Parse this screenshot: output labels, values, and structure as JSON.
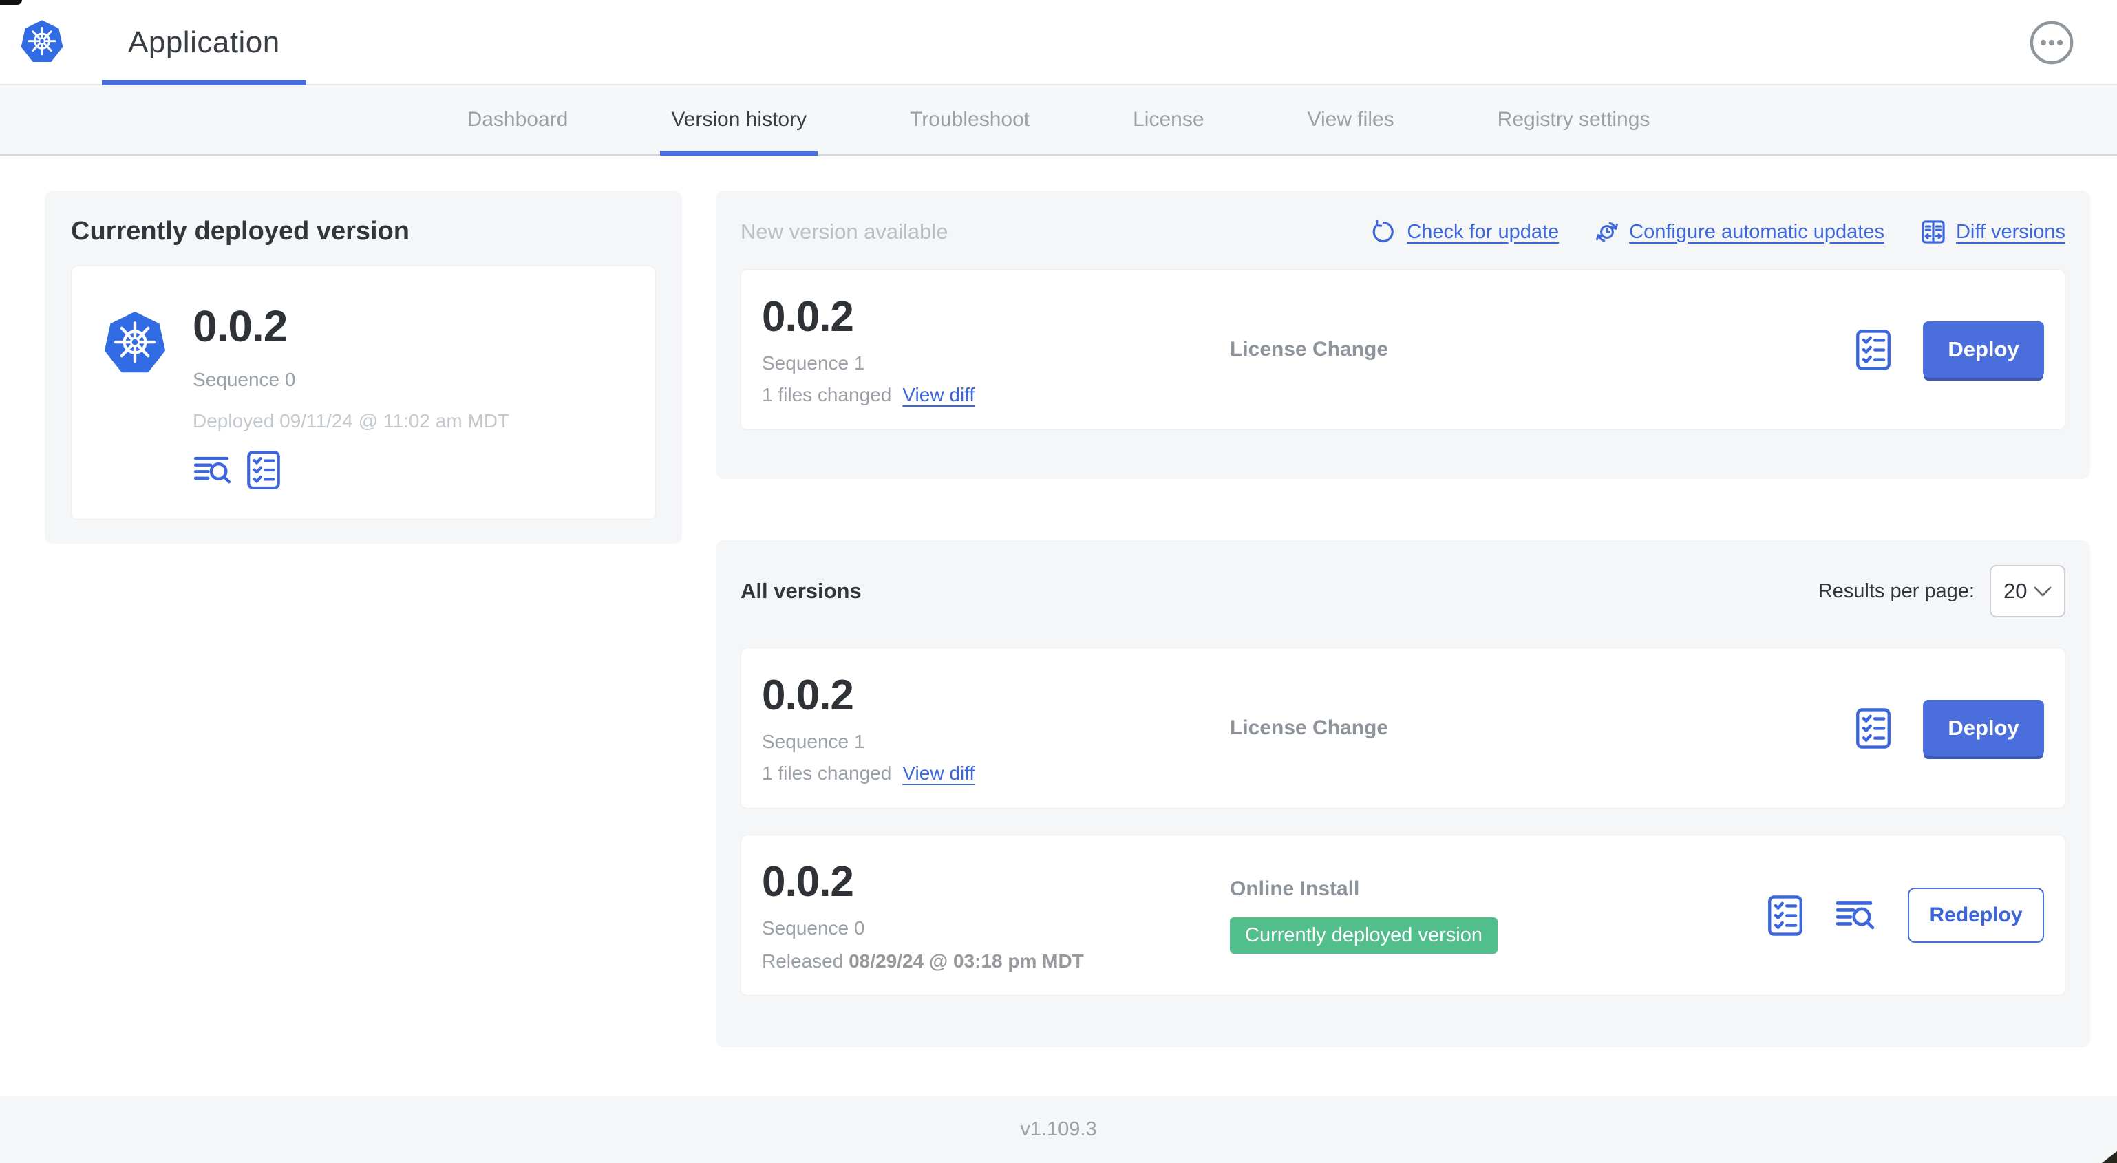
{
  "header": {
    "app_title": "Application"
  },
  "tabs": {
    "items": [
      "Dashboard",
      "Version history",
      "Troubleshoot",
      "License",
      "View files",
      "Registry settings"
    ],
    "active": "Version history"
  },
  "current_version": {
    "title": "Currently deployed version",
    "version": "0.0.2",
    "sequence": "Sequence 0",
    "deployed": "Deployed 09/11/24 @ 11:02 am MDT"
  },
  "new_version": {
    "title": "New version available",
    "actions": {
      "check_for_update": "Check for update",
      "configure_automatic_updates": "Configure automatic updates",
      "diff_versions": "Diff versions"
    },
    "card": {
      "version": "0.0.2",
      "sequence": "Sequence 1",
      "files_changed": "1 files changed",
      "view_diff": "View diff",
      "source": "License Change",
      "action_label": "Deploy"
    }
  },
  "all_versions": {
    "title": "All versions",
    "results_per_page_label": "Results per page:",
    "results_per_page_value": "20",
    "rows": [
      {
        "version": "0.0.2",
        "sequence": "Sequence 1",
        "files_changed": "1 files changed",
        "view_diff": "View diff",
        "source": "License Change",
        "action_label": "Deploy"
      },
      {
        "version": "0.0.2",
        "sequence": "Sequence 0",
        "released_prefix": "Released",
        "released_date": "08/29/24 @ 03:18 pm MDT",
        "source": "Online Install",
        "badge": "Currently deployed version",
        "action_label": "Redeploy"
      }
    ]
  },
  "footer": {
    "version_label": "v1.109.3"
  },
  "icons": {
    "logo": "kubernetes-logo",
    "more": "ellipsis-circle-icon",
    "logs": "deploy-logs-icon",
    "preflight": "preflight-checklist-icon",
    "check_update": "refresh-icon",
    "auto_update": "clock-sync-icon",
    "diff": "diff-columns-icon",
    "select_chevron": "chevron-down-icon"
  },
  "colors": {
    "accent_blue": "#4a6fdc",
    "link_blue": "#3b66dd",
    "kubernetes_blue": "#326ce5",
    "badge_green": "#52be8c",
    "panel_gray": "#f4f6f8",
    "text_dark": "#32363c",
    "text_muted": "#9aa0a6"
  }
}
